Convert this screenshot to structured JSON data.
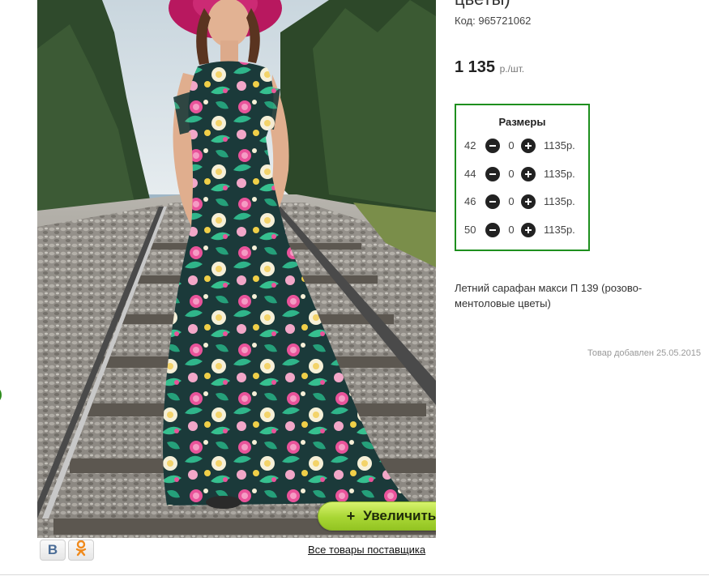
{
  "left_edge": {
    "paren": ")"
  },
  "product": {
    "title_fragment": "цветы)",
    "code_label": "Код:",
    "code_value": "965721062",
    "price_value": "1 135",
    "price_unit": "р./шт.",
    "description": "Летний сарафан макси П 139 (розово-ментоловые цветы)",
    "added_date": "Товар добавлен 25.05.2015"
  },
  "sizes": {
    "title": "Размеры",
    "rows": [
      {
        "size": "42",
        "qty": "0",
        "price": "1135р."
      },
      {
        "size": "44",
        "qty": "0",
        "price": "1135р."
      },
      {
        "size": "46",
        "qty": "0",
        "price": "1135р."
      },
      {
        "size": "50",
        "qty": "0",
        "price": "1135р."
      }
    ]
  },
  "gallery": {
    "zoom_plus": "+",
    "zoom_label": "Увеличить",
    "supplier_link": "Все товары поставщика"
  },
  "social": {
    "vk_letter": "B",
    "vk_icon": "vk-icon",
    "ok_icon": "odnoklassniki-icon"
  },
  "colors": {
    "accent_green": "#1e8f1e",
    "zoom_button": "#a8d634"
  }
}
